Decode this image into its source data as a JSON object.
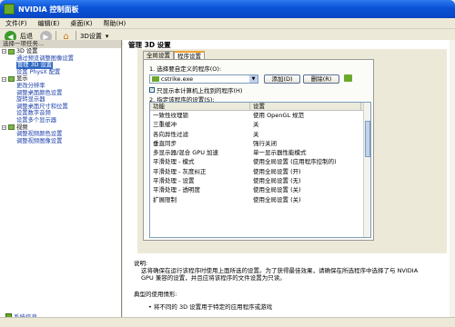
{
  "window": {
    "title": "NVIDIA 控制面板"
  },
  "menu": [
    "文件(F)",
    "编辑(E)",
    "桌面(K)",
    "帮助(H)"
  ],
  "toolbar": {
    "back_label": "后退",
    "page_label": "3D设置"
  },
  "left_pane": {
    "header": "选择一项任务...",
    "tree": [
      {
        "label": "3D 设置",
        "level": 0,
        "category": true,
        "expand": "−"
      },
      {
        "label": "通过预览调整图像设置",
        "level": 1
      },
      {
        "label": "管理 3D 设置",
        "level": 1,
        "selected": true
      },
      {
        "label": "设置 PhysX 配置",
        "level": 1
      },
      {
        "label": "显示",
        "level": 0,
        "category": true,
        "expand": "−"
      },
      {
        "label": "更改分辨率",
        "level": 1
      },
      {
        "label": "调整桌面颜色设置",
        "level": 1
      },
      {
        "label": "旋转显示器",
        "level": 1
      },
      {
        "label": "调整桌面尺寸和位置",
        "level": 1
      },
      {
        "label": "设置数字音频",
        "level": 1
      },
      {
        "label": "设置多个显示器",
        "level": 1
      },
      {
        "label": "视频",
        "level": 0,
        "category": true,
        "expand": "−"
      },
      {
        "label": "调整视频颜色设置",
        "level": 1
      },
      {
        "label": "调整视频图像设置",
        "level": 1
      }
    ],
    "system_info": "系统信息"
  },
  "main": {
    "heading": "管理 3D 设置",
    "tabs": [
      "全局设置",
      "程序设置"
    ],
    "step1": "1. 选择要自定义的程序(O):",
    "selected_program": "cstrike.exe",
    "add_button": "添加(D)",
    "remove_button": "删除(R)",
    "checkbox_label": "只显示本计算机上找到的程序(H)",
    "step2": "2. 指定该程序的设置(S):",
    "grid_headers": [
      "功能",
      "设置"
    ],
    "grid_rows": [
      [
        "一致性纹理锁",
        "使用 OpenGL 规范"
      ],
      [
        "三重缓冲",
        "关"
      ],
      [
        "各向异性过滤",
        "关"
      ],
      [
        "垂直同步",
        "强行关闭"
      ],
      [
        "多显示器/混合 GPU 加速",
        "单一显示器性能模式"
      ],
      [
        "平滑处理 - 模式",
        "使用全局设置 (应用程序控制的)"
      ],
      [
        "平滑处理 - 灰度纠正",
        "使用全局设置 (开)"
      ],
      [
        "平滑处理 - 设置",
        "使用全局设置 (无)"
      ],
      [
        "平滑处理 - 透明度",
        "使用全局设置 (关)"
      ],
      [
        "扩展限制",
        "使用全局设置 (关)"
      ]
    ],
    "description_title": "说明:",
    "description_text": "这将确保在运行该程序时使用上面所选的设置。为了获得最佳效果，请确保在所选程序中选择了与 NVIDIA GPU 兼容的设置，并且应将该程序的文件设置为只读。",
    "usage_title": "典型的使用情形:",
    "usage_bullets": [
      "将不同的 3D 设置用于特定的应用程序或游戏"
    ]
  },
  "colors": {
    "titlebar": "#0a52d6",
    "selection": "#316ac5",
    "nvidia_green": "#6aa92b",
    "link": "#1a3da8"
  }
}
